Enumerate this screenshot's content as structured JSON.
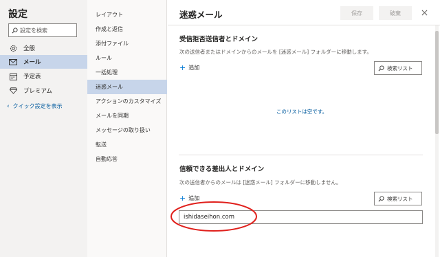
{
  "nav": {
    "title": "設定",
    "search_placeholder": "設定を検索",
    "items": [
      {
        "label": "全般",
        "icon": "gear-icon"
      },
      {
        "label": "メール",
        "icon": "mail-icon"
      },
      {
        "label": "予定表",
        "icon": "calendar-icon"
      },
      {
        "label": "プレミアム",
        "icon": "diamond-icon"
      }
    ],
    "quick_settings": "クイック設定を表示"
  },
  "mid": {
    "items": [
      "レイアウト",
      "作成と返信",
      "添付ファイル",
      "ルール",
      "一括処理",
      "迷惑メール",
      "アクションのカスタマイズ",
      "メールを同期",
      "メッセージの取り扱い",
      "転送",
      "自動応答"
    ],
    "active_index": 5
  },
  "panel": {
    "title": "迷惑メール",
    "save_label": "保存",
    "discard_label": "破棄",
    "blocked": {
      "title": "受信拒否送信者とドメイン",
      "description": "次の送信者またはドメインからのメールを [迷惑メール] フォルダーに移動します。",
      "add_label": "追加",
      "search_label": "検索リスト",
      "empty_text": "このリストは空です。"
    },
    "safe": {
      "title": "信頼できる差出人とドメイン",
      "description": "次の送信者からのメールは [迷惑メール] フォルダーに移動しません。",
      "add_label": "追加",
      "search_label": "検索リスト",
      "input_value": "ishidaseihon.com"
    }
  },
  "colors": {
    "accent": "#0078d4",
    "active_bg": "#c7d5ea",
    "annotation": "#e0201c"
  }
}
